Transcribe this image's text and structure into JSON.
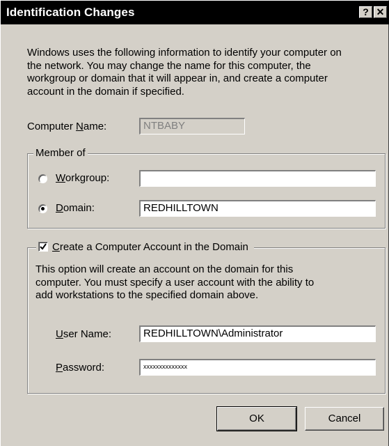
{
  "window": {
    "title": "Identification Changes",
    "help_button": "?",
    "close_button": "✕"
  },
  "intro": {
    "lines": [
      "Windows uses the following information to identify your computer on",
      "the network.  You may change the name for this computer, the",
      "workgroup or domain that it will appear in, and create a computer",
      "account in the domain if specified."
    ]
  },
  "computer_name": {
    "label_pre": "Computer ",
    "label_underlined": "N",
    "label_post": "ame:",
    "value": "NTBABY"
  },
  "member_of": {
    "legend": "Member of",
    "workgroup": {
      "label_underlined": "W",
      "label_post": "orkgroup:",
      "value": "",
      "selected": false
    },
    "domain": {
      "label_underlined": "D",
      "label_post": "omain:",
      "value": "REDHILLTOWN",
      "selected": true
    }
  },
  "create_account": {
    "checkbox_underlined": "C",
    "checkbox_label_post": "reate a Computer Account in the Domain",
    "checked": true,
    "description_lines": [
      "This option will create an account on the domain for this",
      "computer.  You must specify a user account with the ability to",
      "add workstations to the specified domain above."
    ],
    "user_name": {
      "label_underlined": "U",
      "label_post": "ser Name:",
      "value": "REDHILLTOWN\\Administrator"
    },
    "password": {
      "label_underlined": "P",
      "label_post": "assword:",
      "value": "xxxxxxxxxxxxxx"
    }
  },
  "buttons": {
    "ok": "OK",
    "cancel": "Cancel"
  }
}
